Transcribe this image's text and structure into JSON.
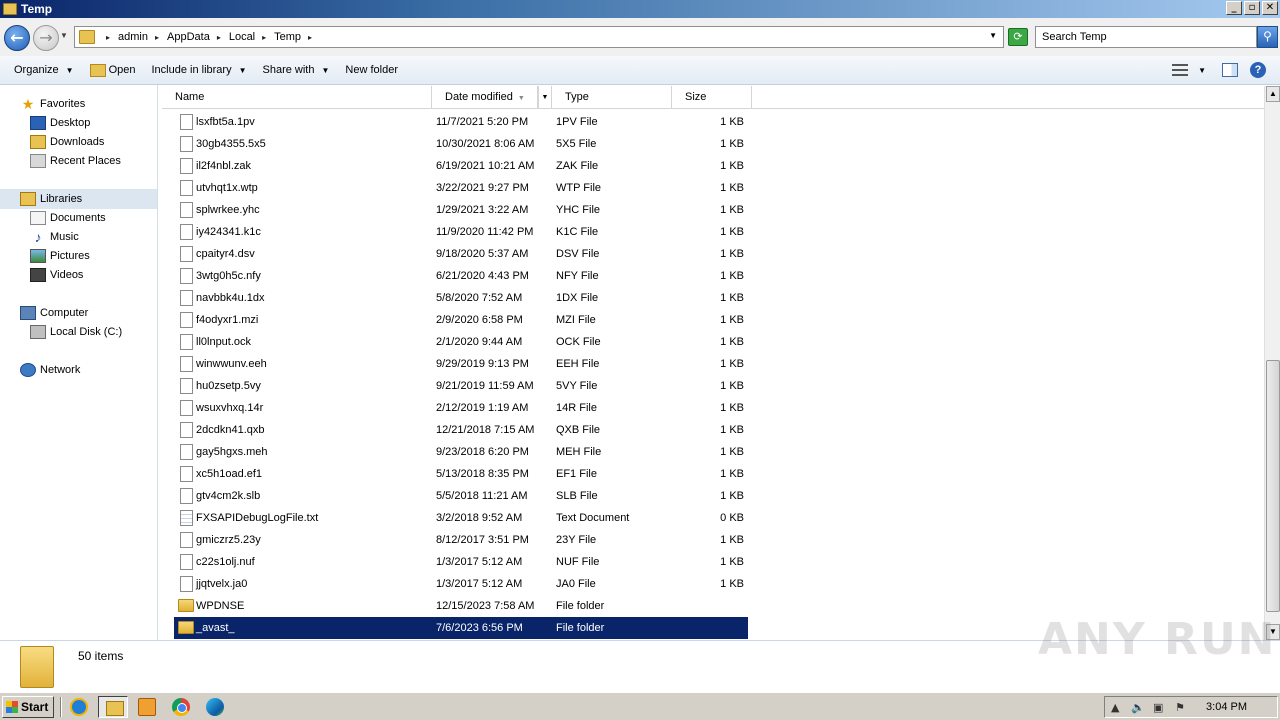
{
  "window": {
    "title": "Temp"
  },
  "address": {
    "crumbs": [
      "admin",
      "AppData",
      "Local",
      "Temp"
    ],
    "search_placeholder": "Search Temp"
  },
  "toolbar": {
    "organize": "Organize",
    "open": "Open",
    "include_in_library": "Include in library",
    "share_with": "Share with",
    "new_folder": "New folder"
  },
  "nav": {
    "favorites": "Favorites",
    "desktop": "Desktop",
    "downloads": "Downloads",
    "recent_places": "Recent Places",
    "libraries": "Libraries",
    "documents": "Documents",
    "music": "Music",
    "pictures": "Pictures",
    "videos": "Videos",
    "computer": "Computer",
    "local_disk": "Local Disk (C:)",
    "network": "Network"
  },
  "columns": {
    "name": "Name",
    "date_modified": "Date modified",
    "type": "Type",
    "size": "Size"
  },
  "files": [
    {
      "name": "lsxfbt5a.1pv",
      "date": "11/7/2021 5:20 PM",
      "type": "1PV File",
      "size": "1 KB",
      "kind": "file"
    },
    {
      "name": "30gb4355.5x5",
      "date": "10/30/2021 8:06 AM",
      "type": "5X5 File",
      "size": "1 KB",
      "kind": "file"
    },
    {
      "name": "il2f4nbl.zak",
      "date": "6/19/2021 10:21 AM",
      "type": "ZAK File",
      "size": "1 KB",
      "kind": "file"
    },
    {
      "name": "utvhqt1x.wtp",
      "date": "3/22/2021 9:27 PM",
      "type": "WTP File",
      "size": "1 KB",
      "kind": "file"
    },
    {
      "name": "splwrkee.yhc",
      "date": "1/29/2021 3:22 AM",
      "type": "YHC File",
      "size": "1 KB",
      "kind": "file"
    },
    {
      "name": "iy424341.k1c",
      "date": "11/9/2020 11:42 PM",
      "type": "K1C File",
      "size": "1 KB",
      "kind": "file"
    },
    {
      "name": "cpaityr4.dsv",
      "date": "9/18/2020 5:37 AM",
      "type": "DSV File",
      "size": "1 KB",
      "kind": "file"
    },
    {
      "name": "3wtg0h5c.nfy",
      "date": "6/21/2020 4:43 PM",
      "type": "NFY File",
      "size": "1 KB",
      "kind": "file"
    },
    {
      "name": "navbbk4u.1dx",
      "date": "5/8/2020 7:52 AM",
      "type": "1DX File",
      "size": "1 KB",
      "kind": "file"
    },
    {
      "name": "f4odyxr1.mzi",
      "date": "2/9/2020 6:58 PM",
      "type": "MZI File",
      "size": "1 KB",
      "kind": "file"
    },
    {
      "name": "ll0lnput.ock",
      "date": "2/1/2020 9:44 AM",
      "type": "OCK File",
      "size": "1 KB",
      "kind": "file"
    },
    {
      "name": "winwwunv.eeh",
      "date": "9/29/2019 9:13 PM",
      "type": "EEH File",
      "size": "1 KB",
      "kind": "file"
    },
    {
      "name": "hu0zsetp.5vy",
      "date": "9/21/2019 11:59 AM",
      "type": "5VY File",
      "size": "1 KB",
      "kind": "file"
    },
    {
      "name": "wsuxvhxq.14r",
      "date": "2/12/2019 1:19 AM",
      "type": "14R File",
      "size": "1 KB",
      "kind": "file"
    },
    {
      "name": "2dcdkn41.qxb",
      "date": "12/21/2018 7:15 AM",
      "type": "QXB File",
      "size": "1 KB",
      "kind": "file"
    },
    {
      "name": "gay5hgxs.meh",
      "date": "9/23/2018 6:20 PM",
      "type": "MEH File",
      "size": "1 KB",
      "kind": "file"
    },
    {
      "name": "xc5h1oad.ef1",
      "date": "5/13/2018 8:35 PM",
      "type": "EF1 File",
      "size": "1 KB",
      "kind": "file"
    },
    {
      "name": "gtv4cm2k.slb",
      "date": "5/5/2018 11:21 AM",
      "type": "SLB File",
      "size": "1 KB",
      "kind": "file"
    },
    {
      "name": "FXSAPIDebugLogFile.txt",
      "date": "3/2/2018 9:52 AM",
      "type": "Text Document",
      "size": "0 KB",
      "kind": "txt"
    },
    {
      "name": "gmiczrz5.23y",
      "date": "8/12/2017 3:51 PM",
      "type": "23Y File",
      "size": "1 KB",
      "kind": "file"
    },
    {
      "name": "c22s1olj.nuf",
      "date": "1/3/2017 5:12 AM",
      "type": "NUF File",
      "size": "1 KB",
      "kind": "file"
    },
    {
      "name": "jjqtvelx.ja0",
      "date": "1/3/2017 5:12 AM",
      "type": "JA0 File",
      "size": "1 KB",
      "kind": "file"
    },
    {
      "name": "WPDNSE",
      "date": "12/15/2023 7:58 AM",
      "type": "File folder",
      "size": "",
      "kind": "folder"
    },
    {
      "name": "_avast_",
      "date": "7/6/2023 6:56 PM",
      "type": "File folder",
      "size": "",
      "kind": "folder",
      "selected": true
    }
  ],
  "details": {
    "item_count": "50 items"
  },
  "watermark": "ANY RUN",
  "taskbar": {
    "start": "Start",
    "clock": "3:04 PM"
  },
  "colors": {
    "selection": "#0a246a",
    "titlebar": "#0a246a"
  }
}
